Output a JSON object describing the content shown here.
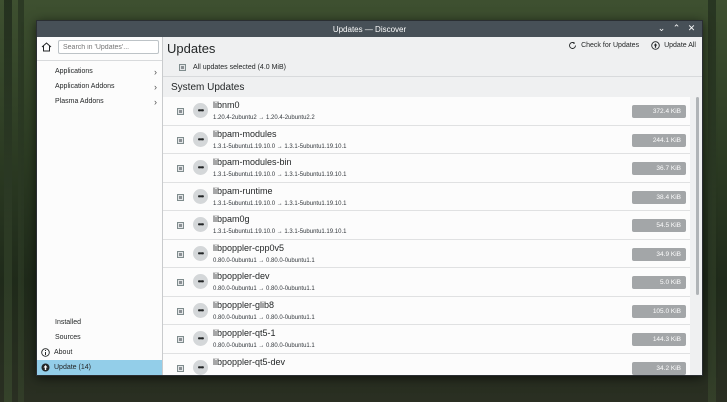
{
  "window": {
    "title": "Updates — Discover",
    "controls": [
      "⌄",
      "⌃",
      "✕"
    ]
  },
  "sidebar": {
    "search_placeholder": "Search in 'Updates'...",
    "categories": [
      {
        "label": "Applications"
      },
      {
        "label": "Application Addons"
      },
      {
        "label": "Plasma Addons"
      }
    ],
    "nav": {
      "installed": "Installed",
      "sources": "Sources",
      "about": "About",
      "update": "Update (14)"
    }
  },
  "main": {
    "title": "Updates",
    "check_updates": "Check for Updates",
    "update_all": "Update All",
    "selection_label": "All updates selected (4.0 MiB)",
    "section_title": "System Updates",
    "packages": [
      {
        "name": "libnm0",
        "version": "1.20.4-2ubuntu2 → 1.20.4-2ubuntu2.2",
        "size": "372.4 KiB"
      },
      {
        "name": "libpam-modules",
        "version": "1.3.1-5ubuntu1.19.10.0 → 1.3.1-5ubuntu1.19.10.1",
        "size": "244.1 KiB"
      },
      {
        "name": "libpam-modules-bin",
        "version": "1.3.1-5ubuntu1.19.10.0 → 1.3.1-5ubuntu1.19.10.1",
        "size": "36.7 KiB"
      },
      {
        "name": "libpam-runtime",
        "version": "1.3.1-5ubuntu1.19.10.0 → 1.3.1-5ubuntu1.19.10.1",
        "size": "38.4 KiB"
      },
      {
        "name": "libpam0g",
        "version": "1.3.1-5ubuntu1.19.10.0 → 1.3.1-5ubuntu1.19.10.1",
        "size": "54.5 KiB"
      },
      {
        "name": "libpoppler-cpp0v5",
        "version": "0.80.0-0ubuntu1 → 0.80.0-0ubuntu1.1",
        "size": "34.9 KiB"
      },
      {
        "name": "libpoppler-dev",
        "version": "0.80.0-0ubuntu1 → 0.80.0-0ubuntu1.1",
        "size": "5.0 KiB"
      },
      {
        "name": "libpoppler-glib8",
        "version": "0.80.0-0ubuntu1 → 0.80.0-0ubuntu1.1",
        "size": "105.0 KiB"
      },
      {
        "name": "libpoppler-qt5-1",
        "version": "0.80.0-0ubuntu1 → 0.80.0-0ubuntu1.1",
        "size": "144.3 KiB"
      },
      {
        "name": "libpoppler-qt5-dev",
        "version": "",
        "size": "34.2 KiB"
      }
    ]
  },
  "colors": {
    "active_nav": "#93cee9",
    "size_badge": "#a3a6a8",
    "titlebar": "#475057"
  }
}
